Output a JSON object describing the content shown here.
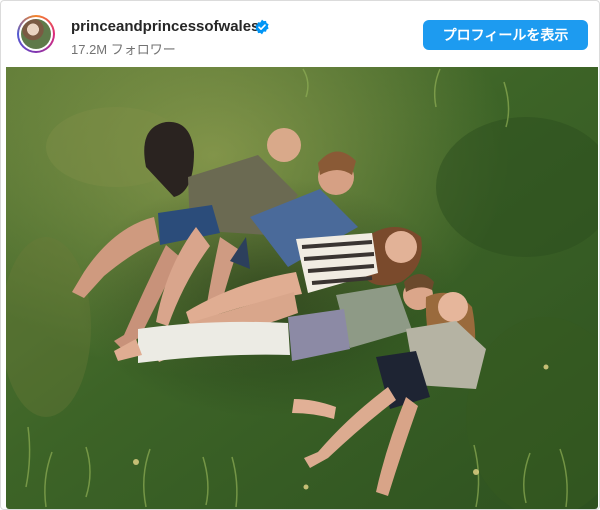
{
  "post": {
    "username": "princeandprincessofwales",
    "followers": "17.2M フォロワー",
    "profile_button": "プロフィールを表示",
    "verified_icon": "verified-badge-icon",
    "avatar_icon": "profile-avatar",
    "photo": "family-on-grass-photo"
  },
  "colors": {
    "button": "#1d9bf0",
    "verified": "#0095f6",
    "grass": "#3f6b2a"
  }
}
